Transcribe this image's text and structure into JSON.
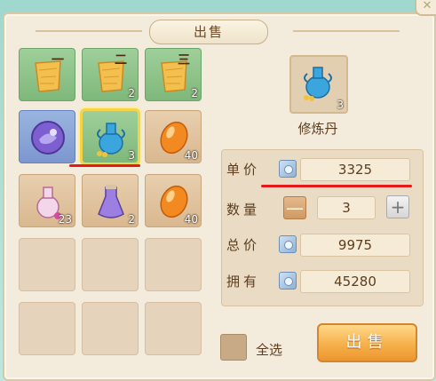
{
  "title": "出售",
  "close_glyph": "✕",
  "inventory": [
    {
      "id": "s1",
      "icon": "scroll-1-icon",
      "badge": "一",
      "count": "",
      "bg": "green"
    },
    {
      "id": "s2",
      "icon": "scroll-2-icon",
      "badge": "二",
      "count": "2",
      "bg": "green"
    },
    {
      "id": "s3",
      "icon": "scroll-3-icon",
      "badge": "三",
      "count": "2",
      "bg": "green"
    },
    {
      "id": "s4",
      "icon": "purple-orb-icon",
      "count": "",
      "bg": "blue"
    },
    {
      "id": "s5",
      "icon": "blue-vase-icon",
      "count": "3",
      "bg": "green",
      "selected": true
    },
    {
      "id": "s6",
      "icon": "orange-gem-icon",
      "count": "40",
      "bg": "tan"
    },
    {
      "id": "s7",
      "icon": "pink-vase-icon",
      "count": "23",
      "bg": "tan"
    },
    {
      "id": "s8",
      "icon": "purple-potion-icon",
      "count": "2",
      "bg": "tan"
    },
    {
      "id": "s9",
      "icon": "orange-gem-icon",
      "count": "40",
      "bg": "tan"
    }
  ],
  "selected_item": {
    "name": "修炼丹",
    "count": "3",
    "icon": "blue-vase-icon"
  },
  "rows": {
    "unit_price": {
      "label": "单价",
      "value": "3325"
    },
    "quantity": {
      "label": "数量",
      "value": "3",
      "minus": "—",
      "plus": "+"
    },
    "total_price": {
      "label": "总价",
      "value": "9975"
    },
    "owned": {
      "label": "拥有",
      "value": "45280"
    }
  },
  "select_all_label": "全选",
  "sell_button_label": "出售",
  "colors": {
    "accent": "#f6b04a",
    "annotation": "#e41a1a"
  }
}
